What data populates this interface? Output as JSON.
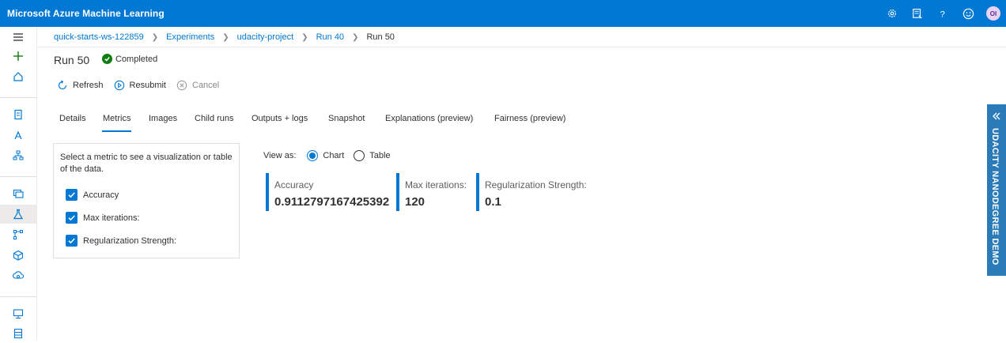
{
  "app": {
    "title": "Microsoft Azure Machine Learning",
    "user_initials": "OI"
  },
  "topbar_icons": [
    "settings-icon",
    "feedback-icon",
    "help-icon",
    "smiley-icon",
    "avatar"
  ],
  "breadcrumb": [
    "quick-starts-ws-122859",
    "Experiments",
    "udacity-project",
    "Run 40",
    "Run 50"
  ],
  "run": {
    "title": "Run 50",
    "status": "Completed"
  },
  "toolbar": {
    "refresh": "Refresh",
    "resubmit": "Resubmit",
    "cancel": "Cancel"
  },
  "tabs": [
    "Details",
    "Metrics",
    "Images",
    "Child runs",
    "Outputs + logs",
    "Snapshot",
    "Explanations (preview)",
    "Fairness (preview)"
  ],
  "selected_tab": "Metrics",
  "metrics_panel": {
    "description": "Select a metric to see a visualization or table of the data.",
    "items": [
      {
        "label": "Accuracy",
        "checked": true
      },
      {
        "label": "Max iterations:",
        "checked": true
      },
      {
        "label": "Regularization Strength:",
        "checked": true
      }
    ]
  },
  "view_as": {
    "label": "View as:",
    "chart": "Chart",
    "table": "Table",
    "selected": "Chart"
  },
  "metric_cards": [
    {
      "label": "Accuracy",
      "value": "0.9112797167425392"
    },
    {
      "label": "Max iterations:",
      "value": "120"
    },
    {
      "label": "Regularization Strength:",
      "value": "0.1"
    }
  ],
  "side_banner": "UDACITY NANODEGREE DEMO",
  "colors": {
    "brand": "#0078d4",
    "success": "#107c10",
    "banner": "#2b7bb9"
  }
}
